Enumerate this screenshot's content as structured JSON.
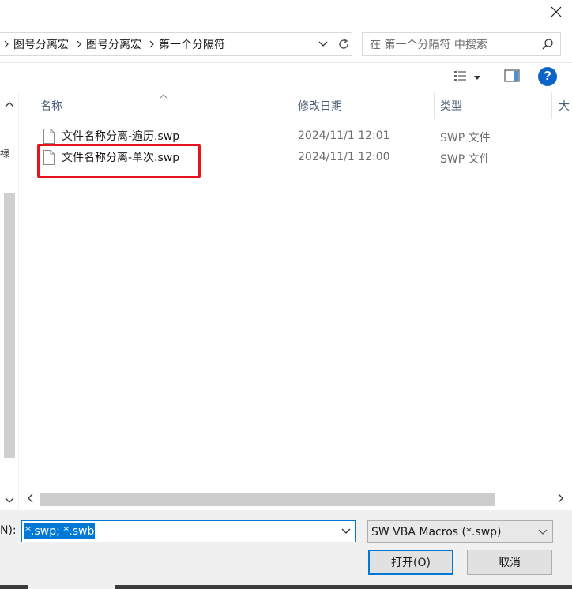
{
  "window": {
    "close_icon": "close-icon"
  },
  "address_bar": {
    "crumbs": [
      "图号分离宏",
      "图号分离宏",
      "第一个分隔符"
    ],
    "icons": [
      "chevron-right-icon",
      "chevron-down-icon",
      "refresh-icon"
    ]
  },
  "search": {
    "placeholder": "在 第一个分隔符 中搜索",
    "icon": "search-icon"
  },
  "toolbar": {
    "view_icon": "view-options-icon",
    "preview_pane_icon": "preview-pane-icon",
    "help_label": "?"
  },
  "nav_pane": {
    "fragment": "禄"
  },
  "columns": {
    "name": "名称",
    "date": "修改日期",
    "type": "类型",
    "size": "大"
  },
  "files": [
    {
      "name": "文件名称分离-遍历.swp",
      "date": "2024/11/1 12:01",
      "type": "SWP 文件"
    },
    {
      "name": "文件名称分离-单次.swp",
      "date": "2024/11/1 12:00",
      "type": "SWP 文件"
    }
  ],
  "bottom": {
    "filename_label": "N):",
    "filename_value": "*.swp; *.swb",
    "filetype_value": "SW VBA Macros (*.swp)",
    "open_label": "打开(O)",
    "cancel_label": "取消"
  },
  "colors": {
    "accent": "#0078d7",
    "highlight_box": "#e8141c",
    "help_bg": "#0c64c8"
  }
}
